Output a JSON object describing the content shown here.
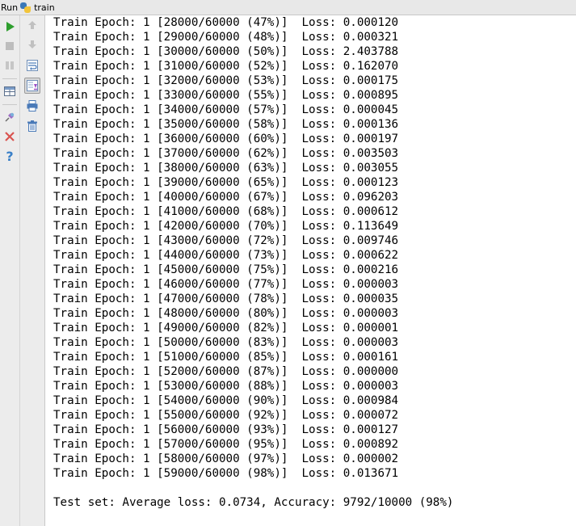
{
  "titlebar": {
    "run_label": "Run",
    "config_name": "train"
  },
  "toolbar_left": [
    {
      "name": "run-icon",
      "color": "#2e9e2e"
    },
    {
      "name": "stop-icon",
      "color": "#b8b8b8"
    },
    {
      "name": "pause-icon",
      "color": "#b8b8b8"
    },
    {
      "name": "layout-icon",
      "color": "#5a7aa8"
    },
    {
      "name": "pin-icon",
      "color": "#8a5aa8"
    },
    {
      "name": "close-icon",
      "color": "#d9534f"
    },
    {
      "name": "help-icon",
      "color": "#3a78b8"
    }
  ],
  "toolbar_right": [
    {
      "name": "up-arrow-icon",
      "color": "#b8b8b8"
    },
    {
      "name": "down-arrow-icon",
      "color": "#b8b8b8"
    },
    {
      "name": "soft-wrap-icon",
      "color": "#4a7ab8"
    },
    {
      "name": "scroll-to-end-icon",
      "color": "#4a7ab8"
    },
    {
      "name": "print-icon",
      "color": "#4a7ab8"
    },
    {
      "name": "trash-icon",
      "color": "#4a7ab8"
    }
  ],
  "console": {
    "lines": [
      "Train Epoch: 1 [28000/60000 (47%)]  Loss: 0.000120",
      "Train Epoch: 1 [29000/60000 (48%)]  Loss: 0.000321",
      "Train Epoch: 1 [30000/60000 (50%)]  Loss: 2.403788",
      "Train Epoch: 1 [31000/60000 (52%)]  Loss: 0.162070",
      "Train Epoch: 1 [32000/60000 (53%)]  Loss: 0.000175",
      "Train Epoch: 1 [33000/60000 (55%)]  Loss: 0.000895",
      "Train Epoch: 1 [34000/60000 (57%)]  Loss: 0.000045",
      "Train Epoch: 1 [35000/60000 (58%)]  Loss: 0.000136",
      "Train Epoch: 1 [36000/60000 (60%)]  Loss: 0.000197",
      "Train Epoch: 1 [37000/60000 (62%)]  Loss: 0.003503",
      "Train Epoch: 1 [38000/60000 (63%)]  Loss: 0.003055",
      "Train Epoch: 1 [39000/60000 (65%)]  Loss: 0.000123",
      "Train Epoch: 1 [40000/60000 (67%)]  Loss: 0.096203",
      "Train Epoch: 1 [41000/60000 (68%)]  Loss: 0.000612",
      "Train Epoch: 1 [42000/60000 (70%)]  Loss: 0.113649",
      "Train Epoch: 1 [43000/60000 (72%)]  Loss: 0.009746",
      "Train Epoch: 1 [44000/60000 (73%)]  Loss: 0.000622",
      "Train Epoch: 1 [45000/60000 (75%)]  Loss: 0.000216",
      "Train Epoch: 1 [46000/60000 (77%)]  Loss: 0.000003",
      "Train Epoch: 1 [47000/60000 (78%)]  Loss: 0.000035",
      "Train Epoch: 1 [48000/60000 (80%)]  Loss: 0.000003",
      "Train Epoch: 1 [49000/60000 (82%)]  Loss: 0.000001",
      "Train Epoch: 1 [50000/60000 (83%)]  Loss: 0.000003",
      "Train Epoch: 1 [51000/60000 (85%)]  Loss: 0.000161",
      "Train Epoch: 1 [52000/60000 (87%)]  Loss: 0.000000",
      "Train Epoch: 1 [53000/60000 (88%)]  Loss: 0.000003",
      "Train Epoch: 1 [54000/60000 (90%)]  Loss: 0.000984",
      "Train Epoch: 1 [55000/60000 (92%)]  Loss: 0.000072",
      "Train Epoch: 1 [56000/60000 (93%)]  Loss: 0.000127",
      "Train Epoch: 1 [57000/60000 (95%)]  Loss: 0.000892",
      "Train Epoch: 1 [58000/60000 (97%)]  Loss: 0.000002",
      "Train Epoch: 1 [59000/60000 (98%)]  Loss: 0.013671"
    ],
    "summary": "Test set: Average loss: 0.0734, Accuracy: 9792/10000 (98%)"
  }
}
